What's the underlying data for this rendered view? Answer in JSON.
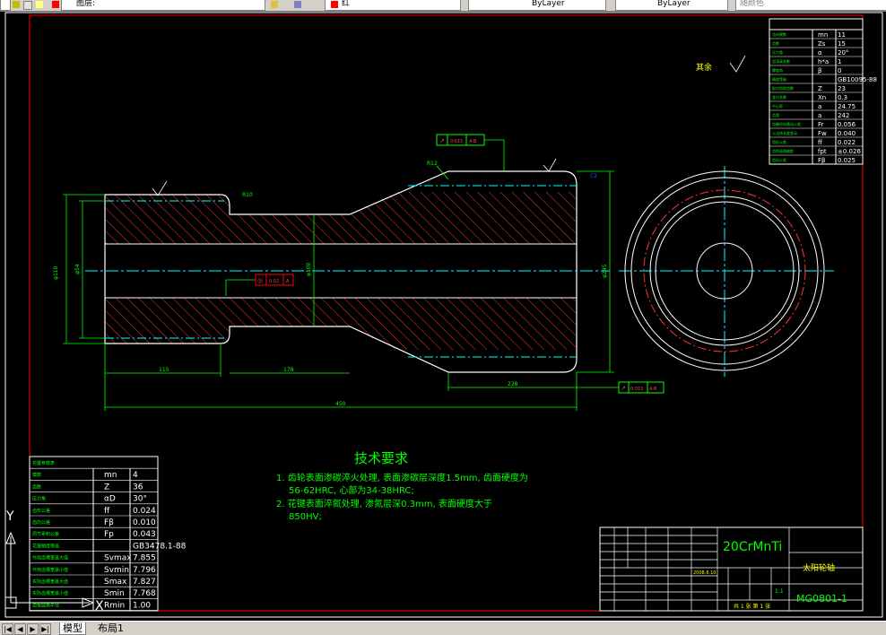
{
  "toolbar": {
    "layer_label": "图层:",
    "layer_value": "红",
    "linetype": "ByLayer",
    "lineweight": "ByLayer",
    "color_label": "随颜色"
  },
  "drawing": {
    "tech_title": "技术要求",
    "tech_lines": [
      "1. 齿轮表面渗碳淬火处理, 表面渗碳层深度1.5mm, 齿面硬度为",
      "56-62HRC, 心部为34-38HRC;",
      "2. 花键表面淬氮处理, 渗氮层深0.3mm, 表面硬度大于",
      "850HV;"
    ],
    "material": "20CrMnTi",
    "part_name": "太阳轮轴",
    "drawing_no": "MG0801-1",
    "scale": "1:1",
    "date": "2008.6.10",
    "sheet": "共 1 张 第 1 张",
    "surface_other": "其余",
    "dims": {
      "total_length": "450",
      "len_115": "115",
      "len_178": "178",
      "len_228": "228",
      "r10": "R10",
      "r10b": "R10",
      "r12": "R12",
      "left_dia": "φ110",
      "left_inner": "φ54",
      "mid_dia": "φ100",
      "right_dia": "φ245",
      "chamfer": "C2"
    },
    "tol_frames": {
      "top": {
        "sym": "↗",
        "val": "0.015",
        "ref": "A-B"
      },
      "bottom": {
        "sym": "↗",
        "val": "0.015",
        "ref": "A-B"
      },
      "mid": {
        "sym": "◎",
        "val": "0.02",
        "ref": "A"
      }
    },
    "gear_params": [
      {
        "name": "法向模数",
        "sym": "mn",
        "val": "11"
      },
      {
        "name": "齿数",
        "sym": "Zs",
        "val": "15"
      },
      {
        "name": "压力角",
        "sym": "α",
        "val": "20°"
      },
      {
        "name": "齿顶高系数",
        "sym": "h*a",
        "val": "1"
      },
      {
        "name": "螺旋角",
        "sym": "β",
        "val": "0"
      },
      {
        "name": "精度等级",
        "sym": "",
        "val": "GB10095-88"
      },
      {
        "name": "配对齿轮齿数",
        "sym": "Z",
        "val": "23"
      },
      {
        "name": "变位系数",
        "sym": "Xn",
        "val": "0.3"
      },
      {
        "name": "中心距",
        "sym": "a",
        "val": "24.75"
      },
      {
        "name": "齿宽",
        "sym": "a",
        "val": "242"
      },
      {
        "name": "齿圈径向跳动公差",
        "sym": "Fr",
        "val": "0.056"
      },
      {
        "name": "公法线长度变动",
        "sym": "Fw",
        "val": "0.040"
      },
      {
        "name": "齿形公差",
        "sym": "ff",
        "val": "0.022"
      },
      {
        "name": "齿距极限偏差",
        "sym": "fpt",
        "val": "±0.026"
      },
      {
        "name": "齿向公差",
        "sym": "Fβ",
        "val": "0.025"
      }
    ],
    "spline_params": [
      {
        "name": "花键参数表",
        "sym": "",
        "val": ""
      },
      {
        "name": "模数",
        "sym": "mn",
        "val": "4"
      },
      {
        "name": "齿数",
        "sym": "Z",
        "val": "36"
      },
      {
        "name": "压力角",
        "sym": "αD",
        "val": "30°"
      },
      {
        "name": "齿形公差",
        "sym": "ff",
        "val": "0.024"
      },
      {
        "name": "齿向公差",
        "sym": "Fβ",
        "val": "0.010"
      },
      {
        "name": "周节累积公差",
        "sym": "Fp",
        "val": "0.043"
      },
      {
        "name": "花键精度等级",
        "sym": "",
        "val": "GB3478.1-88"
      },
      {
        "name": "作用齿槽宽最大值",
        "sym": "Svmax",
        "val": "7.855"
      },
      {
        "name": "作用齿槽宽最小值",
        "sym": "Svmin",
        "val": "7.796"
      },
      {
        "name": "实际齿槽宽最大值",
        "sym": "Smax",
        "val": "7.827"
      },
      {
        "name": "实际齿槽宽最小值",
        "sym": "Smin",
        "val": "7.768"
      },
      {
        "name": "齿根圆角半径",
        "sym": "Rmin",
        "val": "1.00"
      }
    ]
  },
  "status": {
    "tab_model": "模型",
    "tab_layout": "布局1"
  },
  "colors": {
    "background": "#000000",
    "outline": "#ffffff",
    "border_red": "#ff0000",
    "dims_green": "#00ff00",
    "center_cyan": "#00ffff",
    "hatch_red": "#ff3030",
    "text_yellow": "#ffff00"
  }
}
